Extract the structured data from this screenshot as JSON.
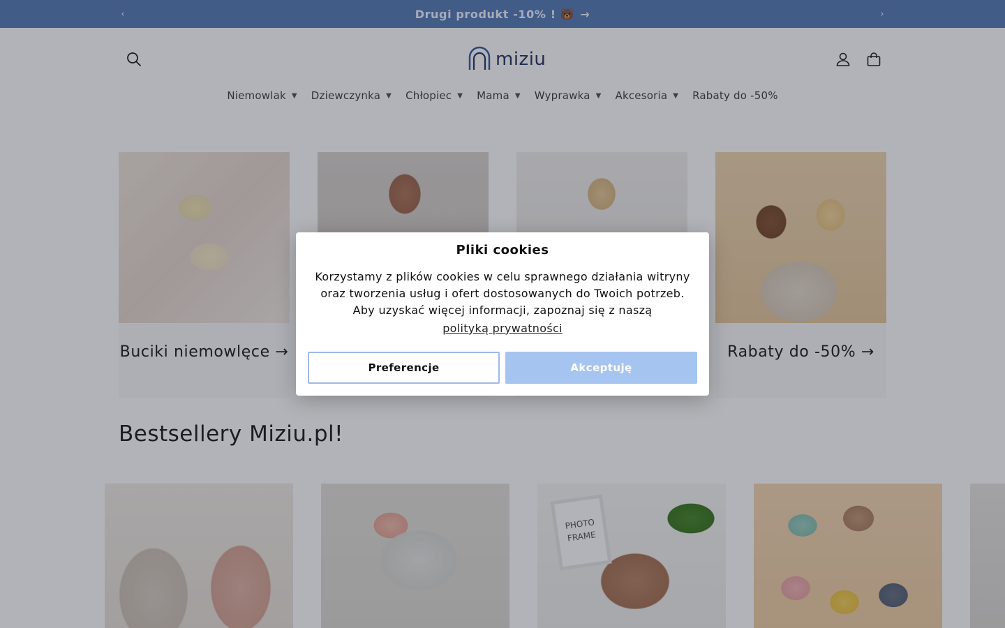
{
  "announcement": {
    "text": "Drugi produkt -10% ! 🐻",
    "arrow": "→",
    "prev_icon": "‹",
    "next_icon": "›"
  },
  "header": {
    "logo_text": "miziu",
    "icons": {
      "search": "search-icon",
      "account": "user-icon",
      "cart": "bag-icon"
    }
  },
  "nav": {
    "items": [
      {
        "label": "Niemowlak",
        "chevron": "▼"
      },
      {
        "label": "Dziewczynka",
        "chevron": "▼"
      },
      {
        "label": "Chłopiec",
        "chevron": "▼"
      },
      {
        "label": "Mama",
        "chevron": "▼"
      },
      {
        "label": "Wyprawka",
        "chevron": "▼"
      },
      {
        "label": "Akcesoria",
        "chevron": "▼"
      },
      {
        "label": "Rabaty do -50%"
      }
    ]
  },
  "categories": [
    {
      "title": "Buciki niemowlęce →"
    },
    {
      "title": ""
    },
    {
      "title": ""
    },
    {
      "title": "Rabaty do -50% →"
    }
  ],
  "bestsellers": {
    "title": "Bestsellery Miziu.pl!",
    "frame_text": "PHOTO FRAME"
  },
  "cookie_dialog": {
    "title": "Pliki cookies",
    "text": "Korzystamy z plików cookies w celu sprawnego działania witryny oraz tworzenia usług i ofert dostosowanych do Twoich potrzeb. Aby uzyskać więcej informacji, zapoznaj się z naszą",
    "link": "polityką prywatności",
    "preferences_button": "Preferencje",
    "accept_button": "Akceptuję"
  },
  "colors": {
    "announcement_bg": "#5b7fb8",
    "accent": "#a6c4f0",
    "logo": "#2b3a64"
  }
}
